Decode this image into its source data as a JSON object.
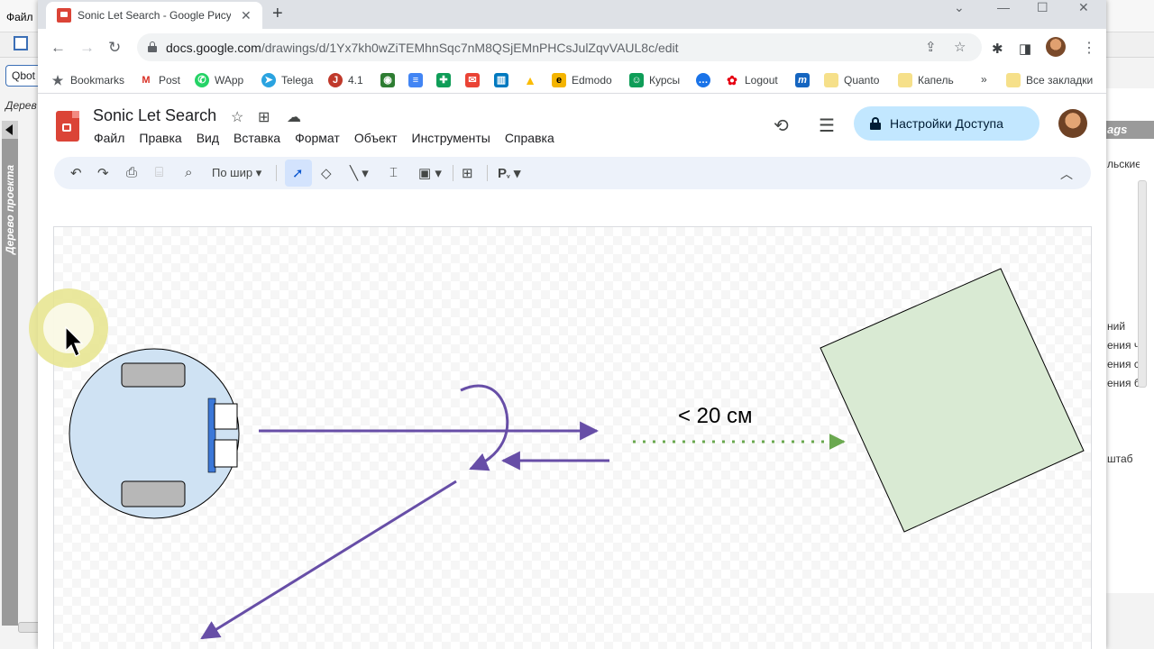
{
  "background_app": {
    "menu_file": "Файл",
    "search_value": "Qbot",
    "tree_label": "Дерев",
    "vertical_label": "Дерево проекта",
    "right_header": "ags",
    "right_lines": [
      "льские",
      "ний",
      "ения ч",
      "ения с",
      "ения б",
      "штаб"
    ]
  },
  "browser": {
    "tab_title": "Sonic Let Search - Google Рисунки",
    "url_host": "docs.google.com",
    "url_path": "/drawings/d/1Yx7kh0wZiTEMhnSqc7nM8QSjEMnPHCsJulZqvVAUL8c/edit",
    "bookmarks": [
      {
        "label": "Bookmarks",
        "icon": "star-icon",
        "color": "#5f6368"
      },
      {
        "label": "Post",
        "icon": "gmail-icon",
        "color": "#d93025"
      },
      {
        "label": "WApp",
        "icon": "whatsapp-icon",
        "color": "#25d366"
      },
      {
        "label": "Telega",
        "icon": "telegram-icon",
        "color": "#2aa3e0"
      },
      {
        "label": "4.1",
        "icon": "app-icon",
        "color": "#c0392b"
      },
      {
        "label": "",
        "icon": "flag-icon",
        "color": "#2e7d32"
      },
      {
        "label": "",
        "icon": "docs-icon",
        "color": "#4285f4"
      },
      {
        "label": "",
        "icon": "sheets-icon",
        "color": "#0f9d58"
      },
      {
        "label": "",
        "icon": "mail-icon",
        "color": "#ea4335"
      },
      {
        "label": "",
        "icon": "trello-icon",
        "color": "#0079bf"
      },
      {
        "label": "",
        "icon": "drive-icon",
        "color": "#fbbc04"
      },
      {
        "label": "Edmodo",
        "icon": "edmodo-icon",
        "color": "#f4b400"
      },
      {
        "label": "Курсы",
        "icon": "classroom-icon",
        "color": "#0f9d58"
      },
      {
        "label": "",
        "icon": "chat-icon",
        "color": "#1a73e8"
      },
      {
        "label": "Logout",
        "icon": "huawei-icon",
        "color": "#e60012"
      },
      {
        "label": "",
        "icon": "m-icon",
        "color": "#1565c0"
      },
      {
        "label": "Quanto",
        "icon": "folder-icon",
        "color": "#f6d365"
      },
      {
        "label": "Капель",
        "icon": "folder-icon",
        "color": "#f6d365"
      }
    ],
    "more_bookmarks": "»",
    "all_bookmarks": "Все закладки"
  },
  "app": {
    "doc_title": "Sonic Let Search",
    "menu": [
      "Файл",
      "Правка",
      "Вид",
      "Вставка",
      "Формат",
      "Объект",
      "Инструменты",
      "Справка"
    ],
    "share_label": "Настройки Доступа",
    "zoom_label": "По шир",
    "input_tool": "Р"
  },
  "drawing": {
    "distance_label": "< 20 см",
    "colors": {
      "robot_body": "#cfe2f3",
      "wheel": "#b7b7b7",
      "sensor_bar": "#3c78d8",
      "arrow": "#674ea7",
      "dotted_arrow": "#6aa84f",
      "obstacle": "#d9ead3"
    }
  }
}
